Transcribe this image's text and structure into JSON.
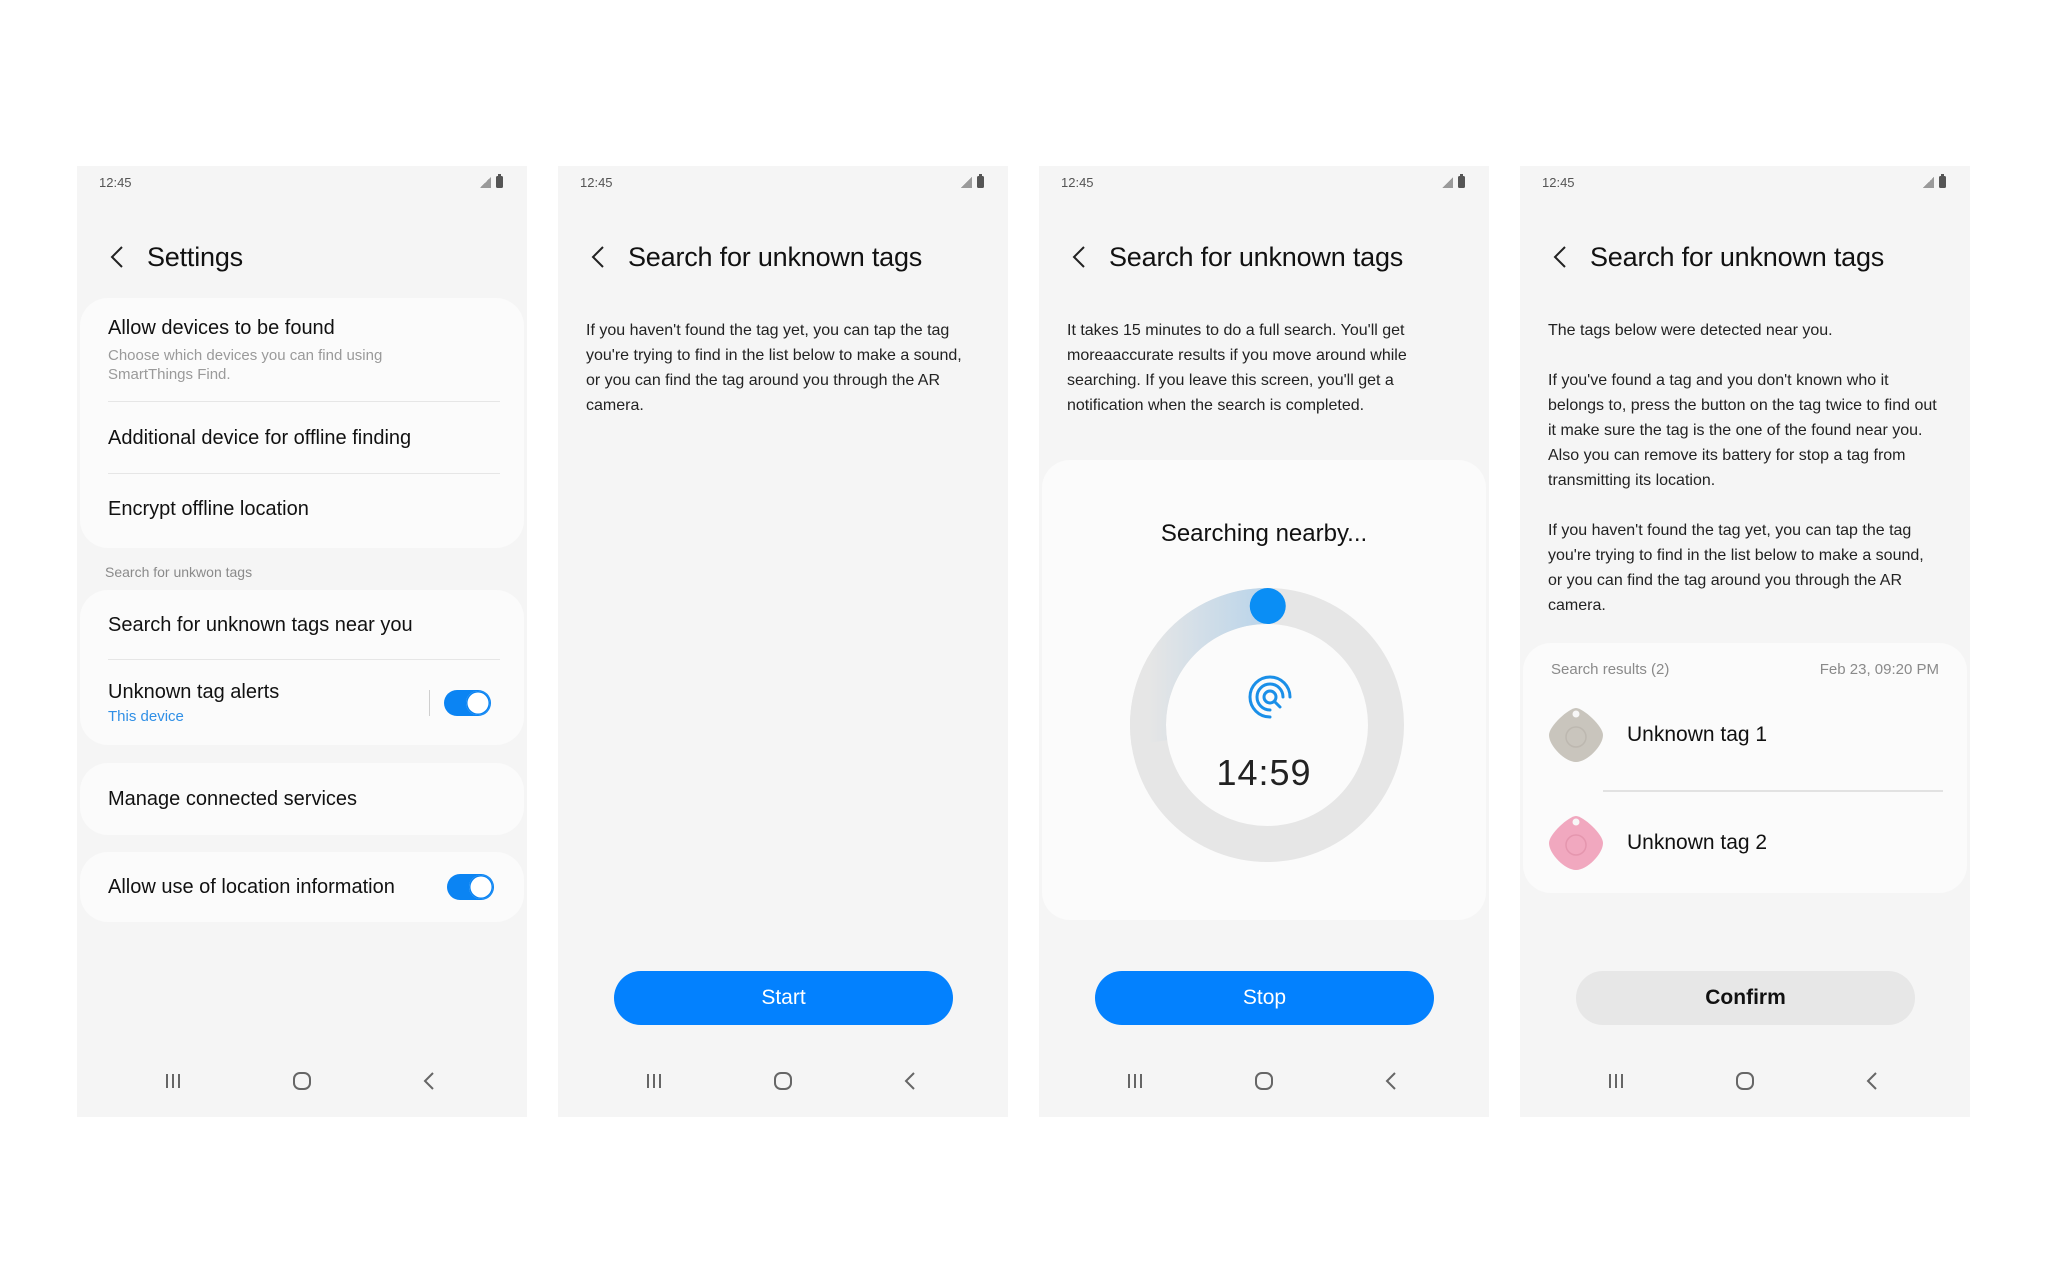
{
  "status_bar": {
    "time": "12:45"
  },
  "colors": {
    "accent": "#0381fe",
    "toggle_on": "#0b84f3",
    "subtitle_blue": "#2f8fe6",
    "tag1": "#c9c5bd",
    "tag2": "#f1a8bf"
  },
  "screens": [
    {
      "title": "Settings",
      "cards": [
        {
          "items": [
            {
              "label": "Allow devices to be found",
              "subtitle": "Choose which devices you can find using SmartThings Find."
            },
            {
              "label": "Additional device for offline finding"
            },
            {
              "label": "Encrypt offline location"
            }
          ]
        }
      ],
      "section_label": "Search for unkwon tags",
      "search_items": [
        {
          "label": "Search for unknown tags near you"
        },
        {
          "label": "Unknown tag alerts",
          "subtitle": "This device",
          "toggle": true
        }
      ],
      "manage_services": "Manage connected services",
      "location": {
        "label": "Allow use of location information",
        "toggle": true
      }
    },
    {
      "title": "Search for unknown tags",
      "paragraphs": [
        "If you haven't found the tag yet, you can tap the tag you're trying to find in the list below to make a sound, or you can find the tag around you through the AR camera."
      ],
      "button": "Start"
    },
    {
      "title": "Search for unknown tags",
      "paragraphs": [
        "It takes 15 minutes to do a full search. You'll get moreaaccurate results if you move around while searching. If you leave this screen, you'll get a notification when the search is completed."
      ],
      "status": "Searching nearby...",
      "timer": "14:59",
      "progress_fraction": 0.001,
      "button": "Stop"
    },
    {
      "title": "Search for unknown tags",
      "paragraphs": [
        "The tags below were detected near you.",
        "If you've found a tag and you don't known who it belongs to, press the button on the tag twice to find out it make sure the tag  is the one of the found near you. Also you can remove its battery for stop a tag from transmitting its location.",
        "If you haven't found the tag yet, you can tap the tag you're trying to find in the list below to make a sound, or you can find the tag around you through the AR camera."
      ],
      "results_label": "Search results (2)",
      "results_time": "Feb 23, 09:20 PM",
      "tags": [
        {
          "name": "Unknown tag 1",
          "color": "oatmeal"
        },
        {
          "name": "Unknown tag 2",
          "color": "pink"
        }
      ],
      "button": "Confirm"
    }
  ]
}
